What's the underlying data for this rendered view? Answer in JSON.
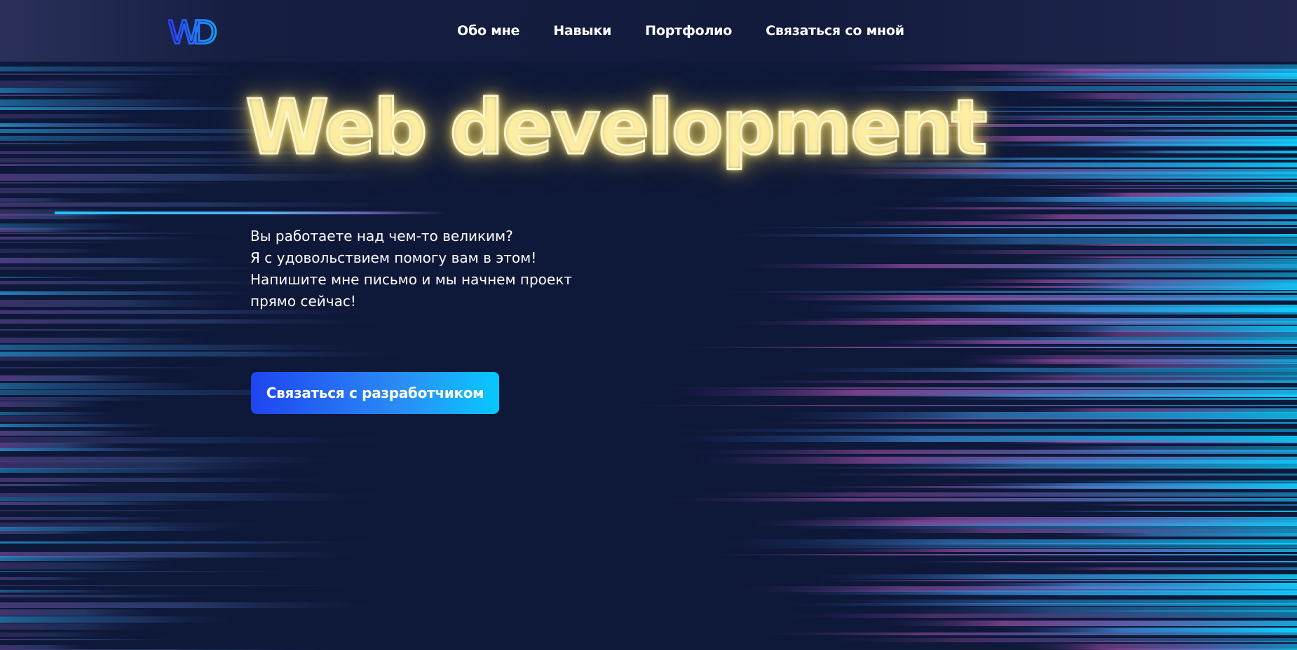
{
  "header": {
    "logo_text": "WD",
    "nav": [
      {
        "label": "Обо мне"
      },
      {
        "label": "Навыки"
      },
      {
        "label": "Портфолио"
      },
      {
        "label": "Связаться со мной"
      }
    ]
  },
  "hero": {
    "title": "Web development",
    "lines": [
      "Вы работаете над чем-то великим?",
      "Я с удовольствием помогу вам в этом!",
      "Напишите мне письмо и мы начнем проект",
      "прямо сейчас!"
    ],
    "cta_label": "Связаться с разработчиком"
  },
  "colors": {
    "background": "#0e1839",
    "accent_blue": "#1e45f0",
    "accent_cyan": "#07c9ff",
    "neon_glow": "#fff6cf",
    "streak_magenta": "#a04fa8"
  }
}
